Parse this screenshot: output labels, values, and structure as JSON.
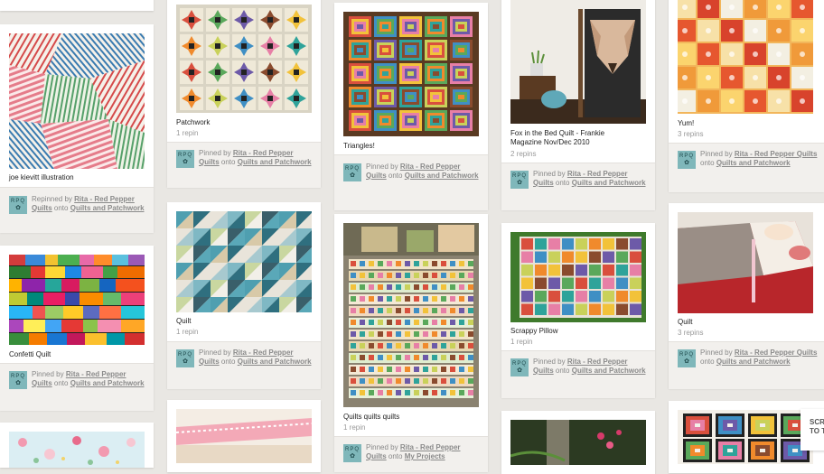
{
  "attr_labels": {
    "pinned_by": "Pinned by",
    "repinned_by": "Repinned by",
    "onto": "onto",
    "user": "Rita - Red Pepper Quilts",
    "board": "Quilts and Patchwork",
    "board_projects": "My Projects",
    "avatar_line1": "RPQ",
    "avatar_line2": "✿"
  },
  "pins": {
    "p1": {
      "description": "joe kievitt illustration",
      "stats": ""
    },
    "p2": {
      "description": "Confetti Quilt",
      "stats": ""
    },
    "p3": {
      "description": "Patchwork",
      "stats": "1 repin"
    },
    "p4": {
      "description": "Quilt",
      "stats": "1 repin"
    },
    "p5": {
      "description": "Triangles!",
      "stats": ""
    },
    "p6": {
      "description": "Quilts quilts quilts",
      "stats": "1 repin"
    },
    "p7": {
      "description": "Fox in the Bed Quilt - Frankie Magazine Nov/Dec 2010",
      "stats": "2 repins"
    },
    "p8": {
      "description": "Scrappy Pillow",
      "stats": "1 repin"
    },
    "p9": {
      "description": "Yum!",
      "stats": "3 repins"
    },
    "p10": {
      "description": "Quilt",
      "stats": "3 repins"
    }
  },
  "scroll_to_top": {
    "line1": "SCRO",
    "line2": "TO T"
  }
}
